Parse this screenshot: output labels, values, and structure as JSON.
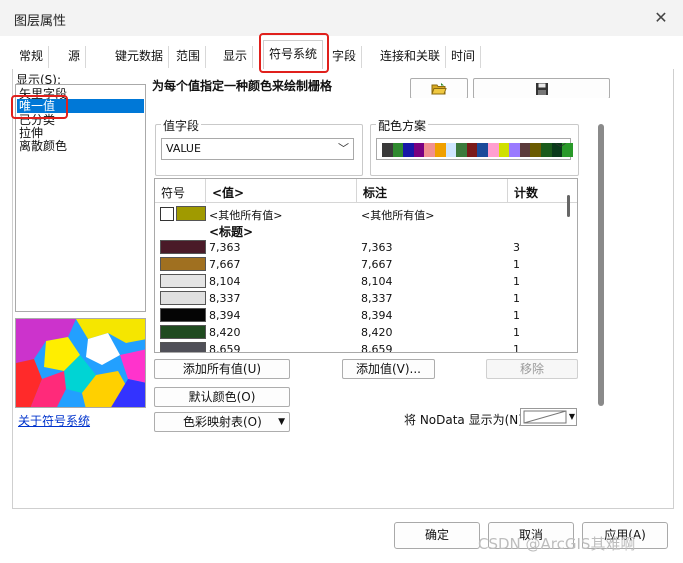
{
  "window": {
    "title": "图层属性"
  },
  "tabs": [
    "常规",
    "源",
    "键元数据",
    "范围",
    "显示",
    "符号系统",
    "字段",
    "连接和关联",
    "时间"
  ],
  "active_tab": "符号系统",
  "show_panel": {
    "label": "显示(S):",
    "items": [
      "矢里字段",
      "唯一值",
      "已分类",
      "拉伸",
      "离散颜色"
    ],
    "selected": "唯一值",
    "about_link": "关于符号系统"
  },
  "main": {
    "heading": "为每个值指定一种颜色来绘制栅格",
    "value_field": {
      "label": "值字段",
      "value": "VALUE"
    },
    "color_scheme": {
      "label": "配色方案",
      "colors": [
        "#3a3a3a",
        "#2f8a2f",
        "#1818a8",
        "#7a0080",
        "#f09090",
        "#f0a000",
        "#cfe6ff",
        "#3c7a3c",
        "#7a1a1a",
        "#1a4a9a",
        "#ff9fcf",
        "#d0e000",
        "#9a7aff",
        "#5a3a3a",
        "#6a5a00",
        "#1a5a1a",
        "#0a3a1a",
        "#2a9a2a"
      ]
    },
    "table": {
      "headers": {
        "symbol": "符号",
        "value": "<值>",
        "label": "标注",
        "count": "计数"
      },
      "other_row": {
        "value": "<其他所有值>",
        "label": "<其他所有值>",
        "swatch": "#a09a00"
      },
      "heading_row": "<标题>",
      "rows": [
        {
          "color": "#4a1a28",
          "value": "7,363",
          "label": "7,363",
          "count": "3"
        },
        {
          "color": "#a07020",
          "value": "7,667",
          "label": "7,667",
          "count": "1"
        },
        {
          "color": "#e4e4e4",
          "value": "8,104",
          "label": "8,104",
          "count": "1"
        },
        {
          "color": "#e0e0e0",
          "value": "8,337",
          "label": "8,337",
          "count": "1"
        },
        {
          "color": "#050505",
          "value": "8,394",
          "label": "8,394",
          "count": "1"
        },
        {
          "color": "#1f4a1f",
          "value": "8,420",
          "label": "8,420",
          "count": "1"
        },
        {
          "color": "#505058",
          "value": "8,659",
          "label": "8,659",
          "count": "1"
        }
      ]
    },
    "buttons": {
      "add_all": "添加所有值(U)",
      "add_values": "添加值(V)...",
      "remove": "移除",
      "default_colors": "默认颜色(O)",
      "colormap": "色彩映射表(O)"
    },
    "nodata_label": "将 NoData 显示为(N)",
    "icons": {
      "open": "folder-open-icon",
      "save": "save-icon"
    }
  },
  "footer": {
    "ok": "确定",
    "cancel": "取消",
    "apply": "应用(A)"
  },
  "watermark": "CSDN @ArcGIS其难啊"
}
